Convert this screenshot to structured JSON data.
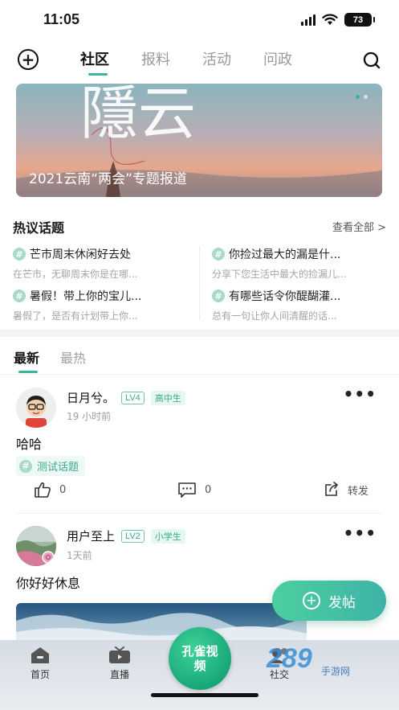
{
  "status_bar": {
    "time": "11:05",
    "battery": "73"
  },
  "top_nav": {
    "tabs": [
      {
        "label": "社区",
        "active": true
      },
      {
        "label": "报料",
        "active": false
      },
      {
        "label": "活动",
        "active": false
      },
      {
        "label": "问政",
        "active": false
      }
    ],
    "icons": {
      "add": "plus-circle-icon",
      "search": "search-icon"
    }
  },
  "banner": {
    "big_text": "隱云",
    "caption": "2021云南“两会”专题报道"
  },
  "hot_topics": {
    "title": "热议话题",
    "more_label": "查看全部",
    "items": [
      {
        "title": "芒市周末休闲好去处",
        "desc": "在芒市，无聊周末你是在哪..."
      },
      {
        "title": "你捡过最大的漏是什...",
        "desc": "分享下您生活中最大的捡漏儿..."
      },
      {
        "title": "暑假！带上你的宝儿...",
        "desc": "暑假了，是否有计划带上你..."
      },
      {
        "title": "有哪些话令你醍醐灌...",
        "desc": "总有一句让你人间清醒的话..."
      }
    ]
  },
  "feed_tabs": [
    {
      "label": "最新",
      "active": true
    },
    {
      "label": "最热",
      "active": false
    }
  ],
  "posts": [
    {
      "author": "日月兮。",
      "level": "LV4",
      "grade": "高中生",
      "time": "19 小时前",
      "content": "哈哈",
      "tag": "测试话题",
      "likes": "0",
      "comments": "0",
      "share_label": "转发"
    },
    {
      "author": "用户至上",
      "level": "LV2",
      "grade": "小学生",
      "time": "1天前",
      "content": "你好好休息"
    }
  ],
  "fab": {
    "label": "发帖"
  },
  "bottom_nav": {
    "items": [
      {
        "label": "首页"
      },
      {
        "label": "直播"
      },
      {
        "label": "孔雀视频"
      },
      {
        "label": "社交"
      }
    ]
  },
  "watermark": {
    "brand": "289",
    "sub": "手游网"
  },
  "colors": {
    "accent": "#39b59a",
    "fab_start": "#4ccf9f",
    "fab_end": "#3eb3a8"
  }
}
